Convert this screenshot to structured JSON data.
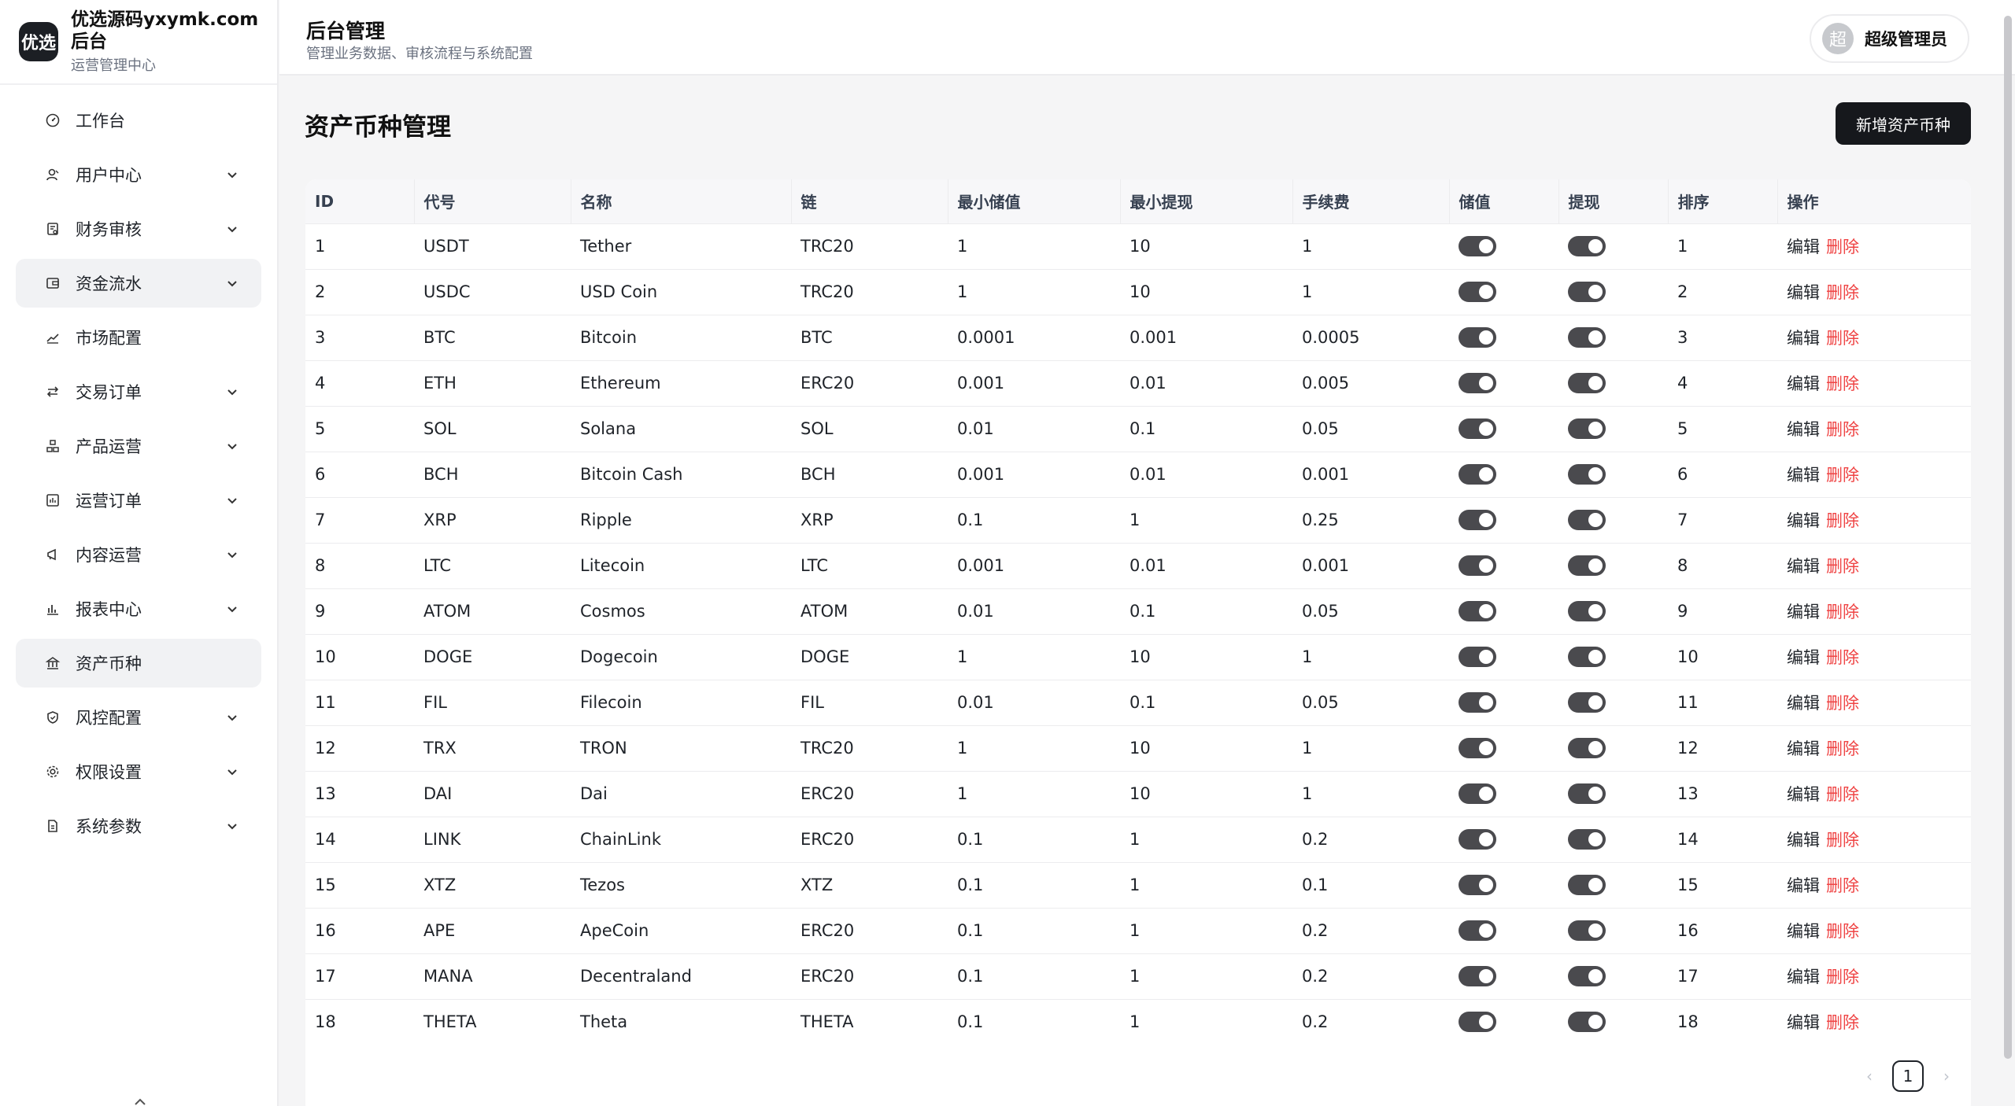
{
  "brand": {
    "logo": "优选",
    "title": "优选源码yxymk.com后台",
    "subtitle": "运营管理中心"
  },
  "sidebar": {
    "items": [
      {
        "label": "工作台",
        "icon": "dashboard-icon",
        "expandable": false,
        "active": false
      },
      {
        "label": "用户中心",
        "icon": "user-icon",
        "expandable": true,
        "active": false
      },
      {
        "label": "财务审核",
        "icon": "audit-icon",
        "expandable": true,
        "active": false
      },
      {
        "label": "资金流水",
        "icon": "wallet-icon",
        "expandable": true,
        "active": true
      },
      {
        "label": "市场配置",
        "icon": "trend-icon",
        "expandable": false,
        "active": false
      },
      {
        "label": "交易订单",
        "icon": "swap-icon",
        "expandable": true,
        "active": false
      },
      {
        "label": "产品运营",
        "icon": "product-icon",
        "expandable": true,
        "active": false
      },
      {
        "label": "运营订单",
        "icon": "order-icon",
        "expandable": true,
        "active": false
      },
      {
        "label": "内容运营",
        "icon": "megaphone-icon",
        "expandable": true,
        "active": false
      },
      {
        "label": "报表中心",
        "icon": "bar-chart-icon",
        "expandable": true,
        "active": false
      },
      {
        "label": "资产币种",
        "icon": "bank-icon",
        "expandable": false,
        "active": true
      },
      {
        "label": "风控配置",
        "icon": "shield-icon",
        "expandable": true,
        "active": false
      },
      {
        "label": "权限设置",
        "icon": "gear-icon",
        "expandable": true,
        "active": false
      },
      {
        "label": "系统参数",
        "icon": "document-icon",
        "expandable": true,
        "active": false
      }
    ]
  },
  "header": {
    "title": "后台管理",
    "subtitle": "管理业务数据、审核流程与系统配置"
  },
  "user": {
    "avatar": "超",
    "name": "超级管理员"
  },
  "main": {
    "title": "资产币种管理",
    "add_label": "新增资产币种"
  },
  "table": {
    "columns": [
      "ID",
      "代号",
      "名称",
      "链",
      "最小储值",
      "最小提现",
      "手续费",
      "储值",
      "提现",
      "排序",
      "操作"
    ],
    "edit_label": "编辑",
    "delete_label": "删除",
    "rows": [
      {
        "id": "1",
        "code": "USDT",
        "name": "Tether",
        "chain": "TRC20",
        "min_deposit": "1",
        "min_withdraw": "10",
        "fee": "1",
        "deposit": true,
        "withdraw": true,
        "sort": "1"
      },
      {
        "id": "2",
        "code": "USDC",
        "name": "USD Coin",
        "chain": "TRC20",
        "min_deposit": "1",
        "min_withdraw": "10",
        "fee": "1",
        "deposit": true,
        "withdraw": true,
        "sort": "2"
      },
      {
        "id": "3",
        "code": "BTC",
        "name": "Bitcoin",
        "chain": "BTC",
        "min_deposit": "0.0001",
        "min_withdraw": "0.001",
        "fee": "0.0005",
        "deposit": true,
        "withdraw": true,
        "sort": "3"
      },
      {
        "id": "4",
        "code": "ETH",
        "name": "Ethereum",
        "chain": "ERC20",
        "min_deposit": "0.001",
        "min_withdraw": "0.01",
        "fee": "0.005",
        "deposit": true,
        "withdraw": true,
        "sort": "4"
      },
      {
        "id": "5",
        "code": "SOL",
        "name": "Solana",
        "chain": "SOL",
        "min_deposit": "0.01",
        "min_withdraw": "0.1",
        "fee": "0.05",
        "deposit": true,
        "withdraw": true,
        "sort": "5"
      },
      {
        "id": "6",
        "code": "BCH",
        "name": "Bitcoin Cash",
        "chain": "BCH",
        "min_deposit": "0.001",
        "min_withdraw": "0.01",
        "fee": "0.001",
        "deposit": true,
        "withdraw": true,
        "sort": "6"
      },
      {
        "id": "7",
        "code": "XRP",
        "name": "Ripple",
        "chain": "XRP",
        "min_deposit": "0.1",
        "min_withdraw": "1",
        "fee": "0.25",
        "deposit": true,
        "withdraw": true,
        "sort": "7"
      },
      {
        "id": "8",
        "code": "LTC",
        "name": "Litecoin",
        "chain": "LTC",
        "min_deposit": "0.001",
        "min_withdraw": "0.01",
        "fee": "0.001",
        "deposit": true,
        "withdraw": true,
        "sort": "8"
      },
      {
        "id": "9",
        "code": "ATOM",
        "name": "Cosmos",
        "chain": "ATOM",
        "min_deposit": "0.01",
        "min_withdraw": "0.1",
        "fee": "0.05",
        "deposit": true,
        "withdraw": true,
        "sort": "9"
      },
      {
        "id": "10",
        "code": "DOGE",
        "name": "Dogecoin",
        "chain": "DOGE",
        "min_deposit": "1",
        "min_withdraw": "10",
        "fee": "1",
        "deposit": true,
        "withdraw": true,
        "sort": "10"
      },
      {
        "id": "11",
        "code": "FIL",
        "name": "Filecoin",
        "chain": "FIL",
        "min_deposit": "0.01",
        "min_withdraw": "0.1",
        "fee": "0.05",
        "deposit": true,
        "withdraw": true,
        "sort": "11"
      },
      {
        "id": "12",
        "code": "TRX",
        "name": "TRON",
        "chain": "TRC20",
        "min_deposit": "1",
        "min_withdraw": "10",
        "fee": "1",
        "deposit": true,
        "withdraw": true,
        "sort": "12"
      },
      {
        "id": "13",
        "code": "DAI",
        "name": "Dai",
        "chain": "ERC20",
        "min_deposit": "1",
        "min_withdraw": "10",
        "fee": "1",
        "deposit": true,
        "withdraw": true,
        "sort": "13"
      },
      {
        "id": "14",
        "code": "LINK",
        "name": "ChainLink",
        "chain": "ERC20",
        "min_deposit": "0.1",
        "min_withdraw": "1",
        "fee": "0.2",
        "deposit": true,
        "withdraw": true,
        "sort": "14"
      },
      {
        "id": "15",
        "code": "XTZ",
        "name": "Tezos",
        "chain": "XTZ",
        "min_deposit": "0.1",
        "min_withdraw": "1",
        "fee": "0.1",
        "deposit": true,
        "withdraw": true,
        "sort": "15"
      },
      {
        "id": "16",
        "code": "APE",
        "name": "ApeCoin",
        "chain": "ERC20",
        "min_deposit": "0.1",
        "min_withdraw": "1",
        "fee": "0.2",
        "deposit": true,
        "withdraw": true,
        "sort": "16"
      },
      {
        "id": "17",
        "code": "MANA",
        "name": "Decentraland",
        "chain": "ERC20",
        "min_deposit": "0.1",
        "min_withdraw": "1",
        "fee": "0.2",
        "deposit": true,
        "withdraw": true,
        "sort": "17"
      },
      {
        "id": "18",
        "code": "THETA",
        "name": "Theta",
        "chain": "THETA",
        "min_deposit": "0.1",
        "min_withdraw": "1",
        "fee": "0.2",
        "deposit": true,
        "withdraw": true,
        "sort": "18"
      }
    ]
  },
  "pagination": {
    "current": "1"
  },
  "colors": {
    "accent": "#16181c",
    "danger": "#ef4444",
    "toggle_on": "#4a4a4e"
  }
}
